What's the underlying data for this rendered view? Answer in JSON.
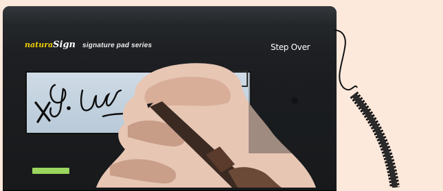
{
  "photo": {
    "subject": "signature-pad",
    "background_color": "#fde9dc",
    "device_color": "#1d1f22",
    "screen_color": "#c4d3e0",
    "led_color": "#9bd65e"
  },
  "brand": {
    "product_prefix": "natura",
    "product_suffix": "Sign",
    "series_label": "signature pad series",
    "maker_logo": "Step Over"
  },
  "screen": {
    "signature_text": "G. Just"
  }
}
